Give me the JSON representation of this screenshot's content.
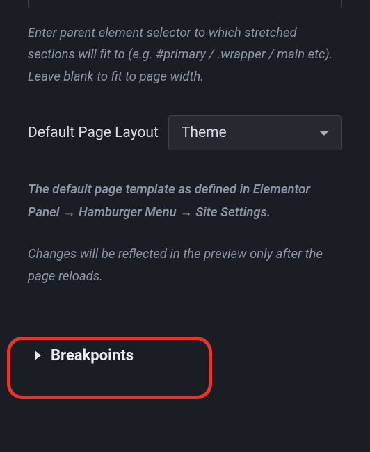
{
  "descriptions": {
    "selector_help": "Enter parent element selector to which stretched sections will fit to (e.g. #primary / .wrapper / main etc). Leave blank to fit to page width.",
    "layout_help_bold": "The default page template as defined in Elementor Panel → Hamburger Menu → Site Settings.",
    "layout_help_note": "Changes will be reflected in the preview only after the page reloads."
  },
  "controls": {
    "default_page_layout": {
      "label": "Default Page Layout",
      "value": "Theme"
    }
  },
  "accordion": {
    "breakpoints_title": "Breakpoints"
  }
}
